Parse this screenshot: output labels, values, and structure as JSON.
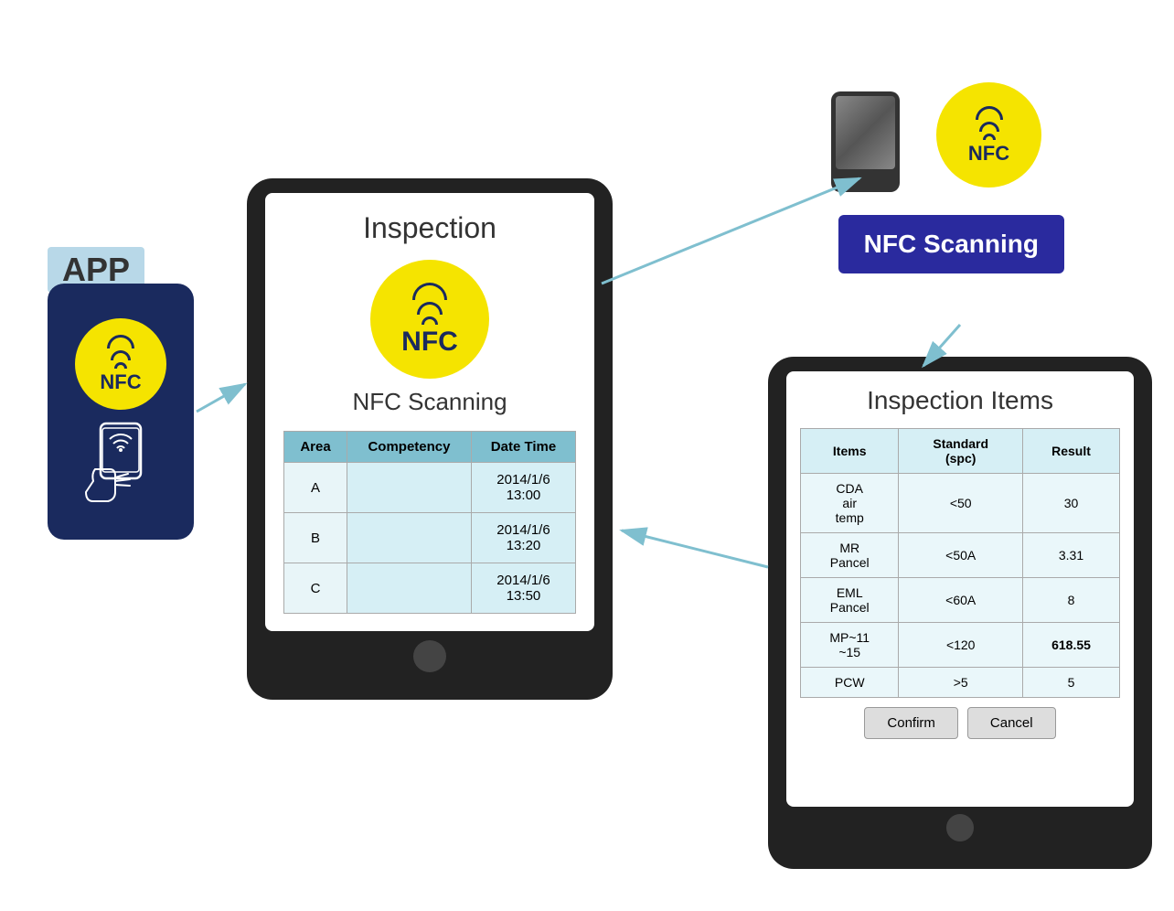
{
  "app_label": "APP",
  "nfc_label": "NFC",
  "nfc_scanning_box": "NFC\nScanning",
  "middle_tablet": {
    "title": "Inspection",
    "nfc_scanning": "NFC Scanning",
    "table": {
      "headers": [
        "Area",
        "Competency",
        "Date Time"
      ],
      "rows": [
        {
          "area": "A",
          "competency": "",
          "datetime": "2014/1/6\n13:00"
        },
        {
          "area": "B",
          "competency": "",
          "datetime": "2014/1/6\n13:20"
        },
        {
          "area": "C",
          "competency": "",
          "datetime": "2014/1/6\n13:50"
        }
      ]
    }
  },
  "right_tablet": {
    "title": "Inspection Items",
    "table": {
      "headers": [
        "Items",
        "Standard\n(spc)",
        "Result"
      ],
      "rows": [
        {
          "items": "CDA\nair\ntemp",
          "standard": "<50",
          "result": "30",
          "alert": false
        },
        {
          "items": "MR\nPancel",
          "standard": "<50A",
          "result": "3.31",
          "alert": false
        },
        {
          "items": "EML\nPancel",
          "standard": "<60A",
          "result": "8",
          "alert": false
        },
        {
          "items": "MP~11\n~15",
          "standard": "<120",
          "result": "618.55",
          "alert": true
        },
        {
          "items": "PCW",
          "standard": ">5",
          "result": "5",
          "alert": false
        }
      ]
    },
    "confirm_btn": "Confirm",
    "cancel_btn": "Cancel"
  }
}
